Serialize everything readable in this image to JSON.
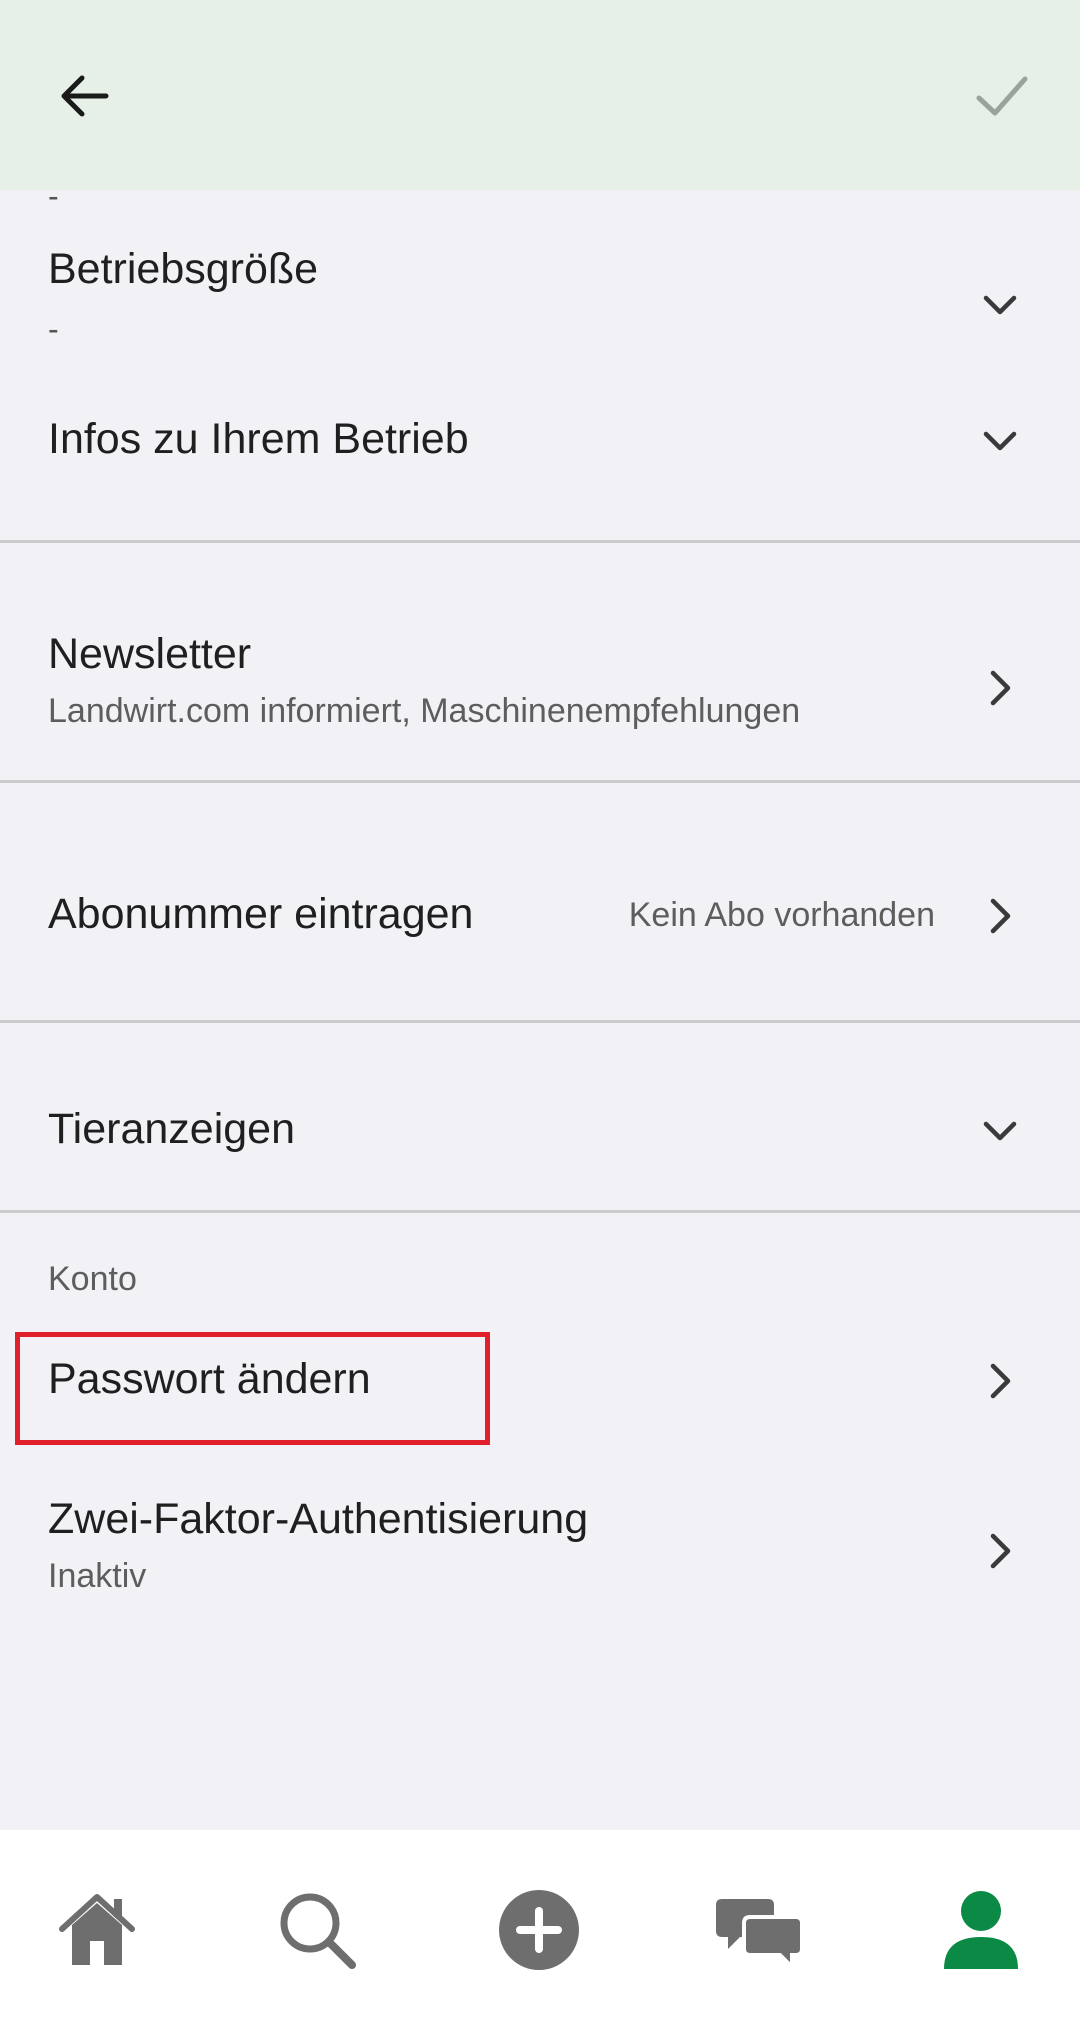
{
  "header": {
    "back_icon": "arrow-left-icon",
    "confirm_icon": "check-icon"
  },
  "settings": {
    "top_partial_value": "-",
    "betriebsgroesse": {
      "label": "Betriebsgröße",
      "value": "-"
    },
    "infos": {
      "label": "Infos zu Ihrem Betrieb"
    },
    "newsletter": {
      "label": "Newsletter",
      "subtitle": "Landwirt.com informiert, Maschinenempfehlungen"
    },
    "abo": {
      "label": "Abonummer eintragen",
      "value": "Kein Abo vorhanden"
    },
    "tieranzeigen": {
      "label": "Tieranzeigen"
    },
    "konto_section": "Konto",
    "passwort": {
      "label": "Passwort ändern"
    },
    "zwei_faktor": {
      "label": "Zwei-Faktor-Authentisierung",
      "subtitle": "Inaktiv"
    }
  },
  "bottom_nav": {
    "items": [
      "home-icon",
      "search-icon",
      "add-icon",
      "chat-icon",
      "profile-icon"
    ],
    "active": "profile-icon",
    "active_color": "#0b8a45",
    "inactive_color": "#6e6e6e"
  },
  "colors": {
    "appbar": "#e6f0e7",
    "background": "#f2f1f6",
    "highlight": "#e0202a"
  }
}
